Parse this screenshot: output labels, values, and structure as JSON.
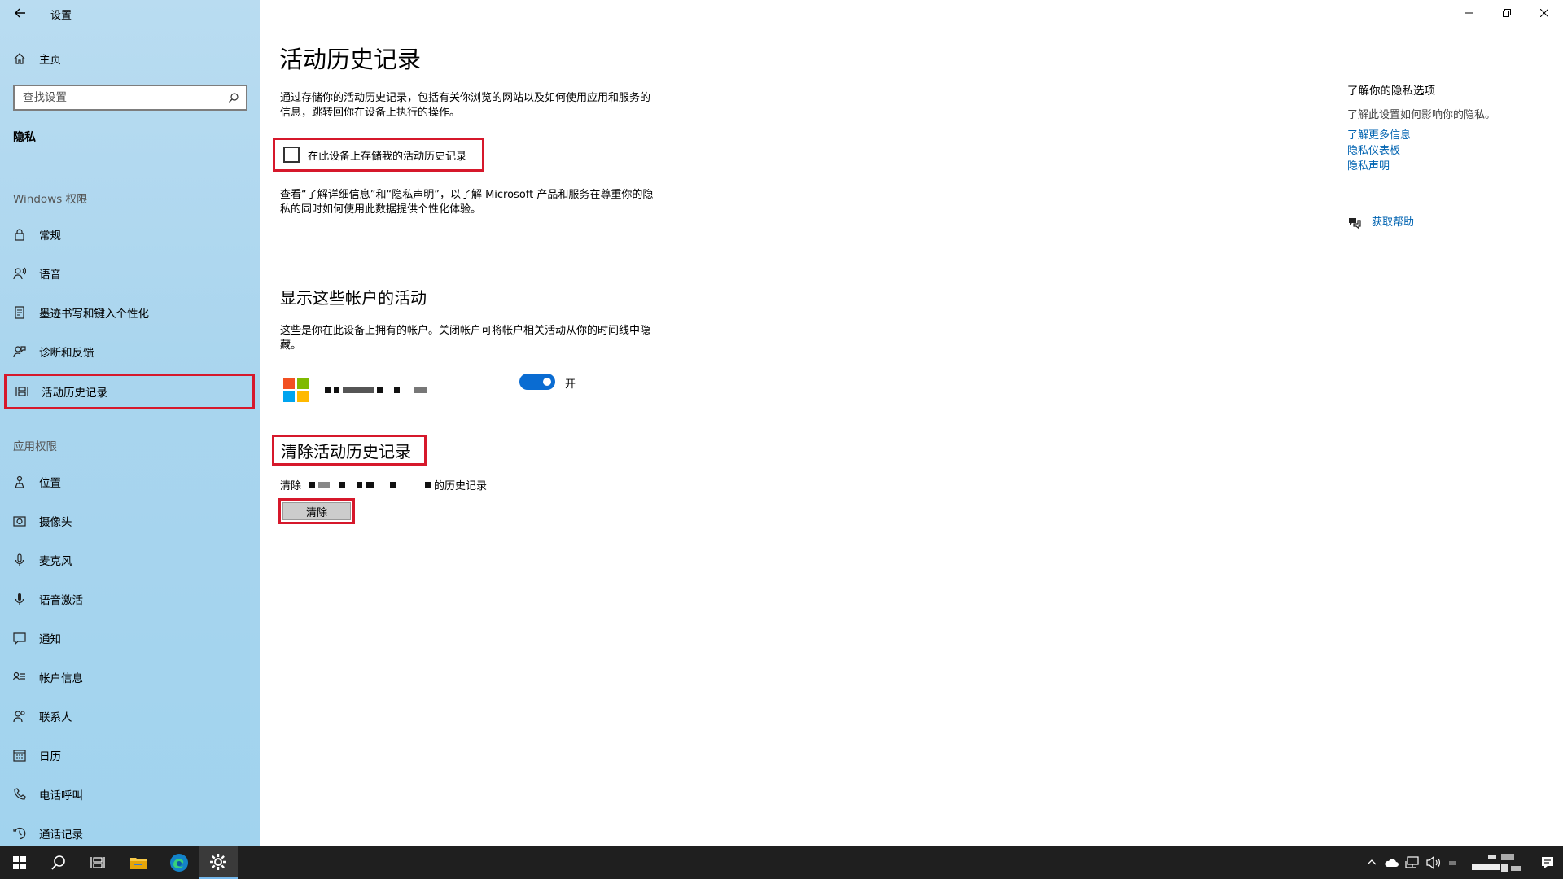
{
  "window": {
    "title": "设置"
  },
  "sidebar": {
    "home_label": "主页",
    "search_placeholder": "查找设置",
    "privacy_title": "隐私",
    "windows_section": "Windows 权限",
    "windows_items": [
      {
        "label": "常规",
        "icon": "lock-icon"
      },
      {
        "label": "语音",
        "icon": "speech-icon"
      },
      {
        "label": "墨迹书写和键入个性化",
        "icon": "ink-icon"
      },
      {
        "label": "诊断和反馈",
        "icon": "feedback-icon"
      },
      {
        "label": "活动历史记录",
        "icon": "timeline-icon",
        "active": true
      }
    ],
    "app_section": "应用权限",
    "app_items": [
      {
        "label": "位置",
        "icon": "location-icon"
      },
      {
        "label": "摄像头",
        "icon": "camera-icon"
      },
      {
        "label": "麦克风",
        "icon": "microphone-icon"
      },
      {
        "label": "语音激活",
        "icon": "voice-activation-icon"
      },
      {
        "label": "通知",
        "icon": "notification-icon"
      },
      {
        "label": "帐户信息",
        "icon": "account-info-icon"
      },
      {
        "label": "联系人",
        "icon": "contacts-icon"
      },
      {
        "label": "日历",
        "icon": "calendar-icon"
      },
      {
        "label": "电话呼叫",
        "icon": "phone-icon"
      },
      {
        "label": "通话记录",
        "icon": "call-history-icon"
      }
    ]
  },
  "main": {
    "title": "活动历史记录",
    "intro": "通过存储你的活动历史记录，包括有关你浏览的网站以及如何使用应用和服务的信息，跳转回你在设备上执行的操作。",
    "store_checkbox_label": "在此设备上存储我的活动历史记录",
    "store_checkbox_checked": false,
    "learn_text": "查看“了解详细信息”和“隐私声明”，以了解 Microsoft 产品和服务在尊重你的隐私的同时如何使用此数据提供个性化体验。",
    "accounts_title": "显示这些帐户的活动",
    "accounts_desc": "这些是你在此设备上拥有的帐户。关闭帐户可将帐户相关活动从你的时间线中隐藏。",
    "account_toggle_on": true,
    "account_toggle_label": "开",
    "clear_title": "清除活动历史记录",
    "clear_prefix": "清除",
    "clear_suffix": "的历史记录",
    "clear_button": "清除"
  },
  "right_panel": {
    "title": "了解你的隐私选项",
    "desc": "了解此设置如何影响你的隐私。",
    "links": [
      "了解更多信息",
      "隐私仪表板",
      "隐私声明"
    ],
    "help": "获取帮助"
  },
  "colors": {
    "accent": "#0a6cd2",
    "highlight_border": "#d6182b",
    "link": "#0063b1"
  }
}
